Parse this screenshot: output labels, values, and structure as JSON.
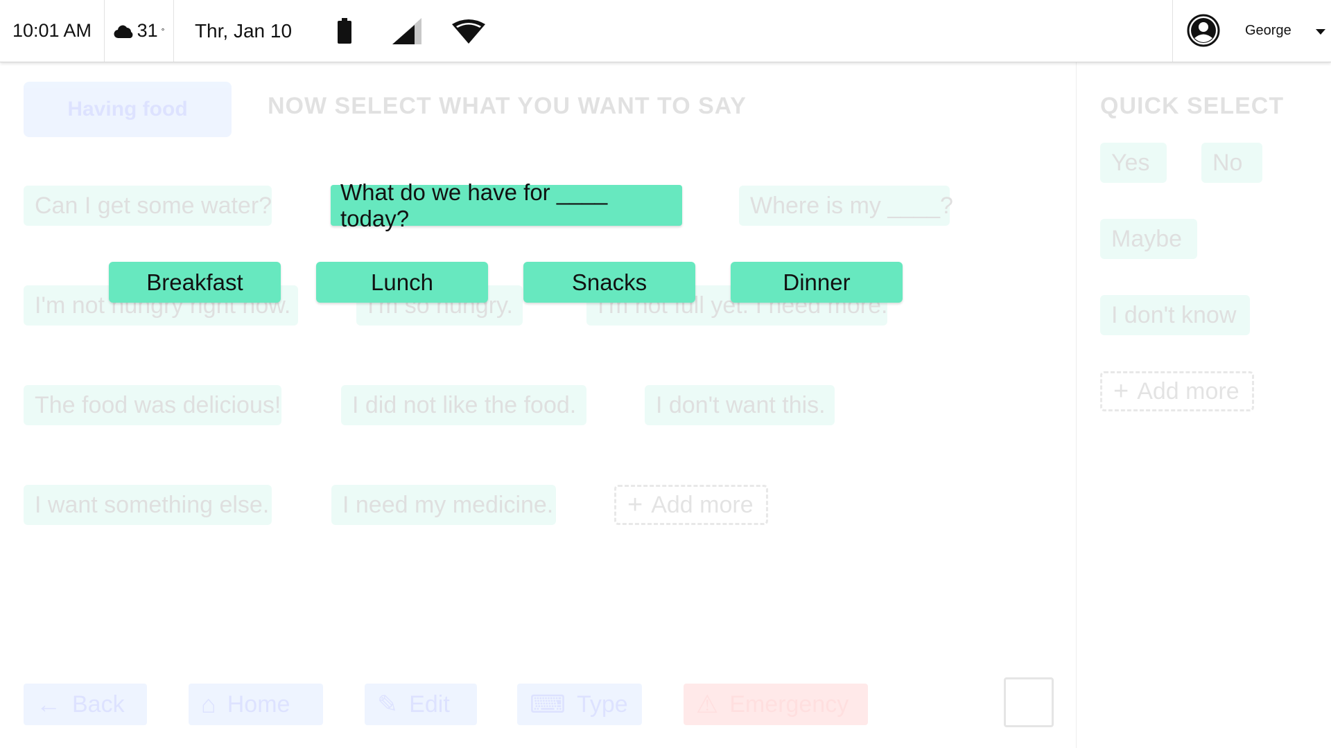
{
  "status_bar": {
    "time": "10:01 AM",
    "weather": {
      "icon": "cloud-icon",
      "temperature": "31",
      "unit": "°"
    },
    "date": "Thr, Jan 10",
    "icons": [
      "battery-icon",
      "cellular-signal-icon",
      "wifi-icon"
    ],
    "user": {
      "name": "George",
      "avatar_icon": "account-circle-icon"
    }
  },
  "background": {
    "topic_button": "Having food",
    "heading": "NOW SELECT WHAT YOU WANT TO SAY",
    "phrases": [
      "Can I get some water?",
      "Where is my ____?",
      "I'm not hungry right now.",
      "I'm so hungry.",
      "I'm not full yet. I need more.",
      "The food was delicious!",
      "I  did not like the food.",
      "I don't want this.",
      "I want something else.",
      "I need my medicine."
    ],
    "add_more": "Add more",
    "quick_select": {
      "heading": "QUICK SELECT",
      "items": [
        "Yes",
        "No",
        "Maybe",
        "I don't know"
      ],
      "add_more": "Add more"
    },
    "nav": {
      "back": "Back",
      "home": "Home",
      "edit": "Edit",
      "type": "Type",
      "emergency": "Emergency"
    }
  },
  "popup": {
    "selected_phrase": "What do we have for ____ today?",
    "options": [
      "Breakfast",
      "Lunch",
      "Snacks",
      "Dinner"
    ]
  },
  "colors": {
    "phrase_green": "#67e8bf",
    "topic_blue": "#8ab8ff",
    "emergency_red": "#ff6d6d"
  }
}
